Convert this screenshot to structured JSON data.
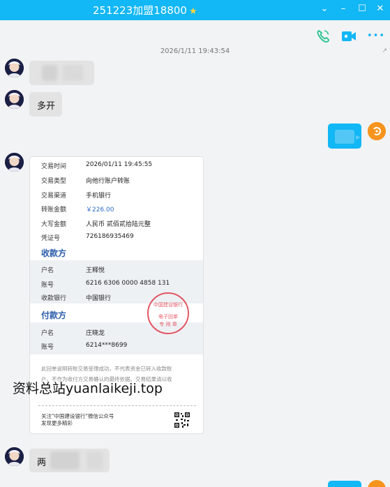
{
  "window": {
    "title": "251223加盟18800",
    "star": "★",
    "minimize": "⌄",
    "restore": "–",
    "maximize": "☐",
    "close": "✕"
  },
  "toolbar": {
    "voice_call_icon": "phone-icon",
    "video_call_icon": "video-camera-icon",
    "more_icon": "more-dots-icon",
    "more_label": "•••"
  },
  "chat": {
    "timestamp": "2026/1/11 19:43:54",
    "corner_mark": "↗",
    "message_2": "多开",
    "message_last_prefix": "两"
  },
  "receipt": {
    "rows_top": [
      {
        "label": "交易时间",
        "value": "2026/01/11 19:45:55"
      },
      {
        "label": "交易类型",
        "value": "向他行账户转账"
      },
      {
        "label": "交易渠道",
        "value": "手机银行"
      },
      {
        "label": "转账金额",
        "value": "￥226.00"
      },
      {
        "label": "大写金额",
        "value": "人民币 贰佰贰拾陆元整"
      },
      {
        "label": "凭证号",
        "value": "726186935469"
      }
    ],
    "payee_header": "收款方",
    "payee_rows": [
      {
        "label": "户名",
        "value": "王释悦"
      },
      {
        "label": "账号",
        "value": "6216 6306 0000 4858 131"
      },
      {
        "label": "收款银行",
        "value": "中国银行"
      }
    ],
    "payer_header": "付款方",
    "payer_rows": [
      {
        "label": "户名",
        "value": "庄晓龙"
      },
      {
        "label": "账号",
        "value": "6214***8699"
      }
    ],
    "notice_line1": "此回单说明转账交易受理成功，不代表资金已转入收款账",
    "notice_line2": "户，不作为收付方交易确认的最终依据。交易结果请以收",
    "follow_line1": "关注\"中国建设银行\"微信公众号",
    "follow_line2": "发现更多精彩",
    "stamp_top": "中国建设银行",
    "stamp_mid": "电子回单",
    "stamp_bottom": "专 用 章",
    "amount_color": "#2a6ac8"
  },
  "watermark": "资料总站yuanlaikeji.top",
  "colors": {
    "titlebar": "#12b7f5",
    "accent_green": "#23c28c",
    "accent_blue": "#12b7f5"
  }
}
